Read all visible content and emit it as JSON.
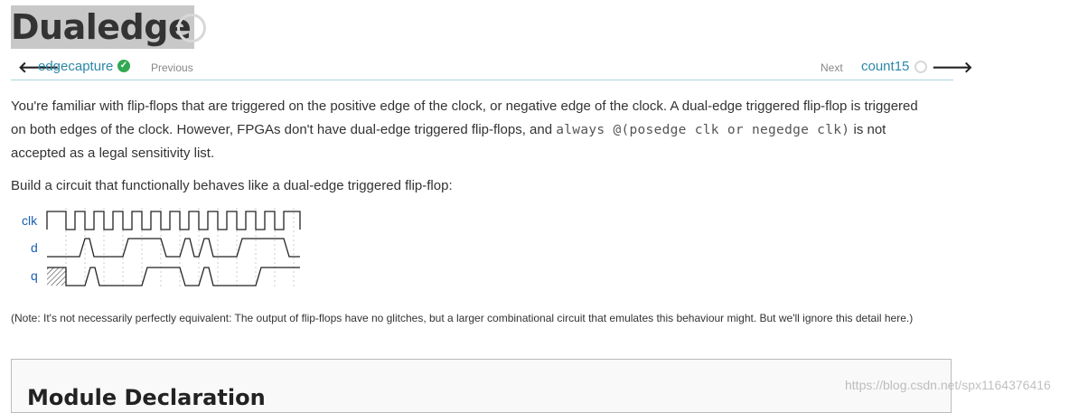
{
  "page": {
    "title": "Dualedge"
  },
  "nav": {
    "prev_problem": "edgecapture",
    "prev_label": "Previous",
    "next_label": "Next",
    "next_problem": "count15"
  },
  "content": {
    "p1_a": "You're familiar with flip-flops that are triggered on the positive edge of the clock, or negative edge of the clock. A dual-edge triggered flip-flop is triggered on both edges of the clock. However, FPGAs don't have dual-edge triggered flip-flops, and ",
    "p1_code": "always @(posedge clk or negedge clk)",
    "p1_b": " is not accepted as a legal sensitivity list.",
    "p2": "Build a circuit that functionally behaves like a dual-edge triggered flip-flop:",
    "note": "(Note: It's not necessarily perfectly equivalent: The output of flip-flops have no glitches, but a larger combinational circuit that emulates this behaviour might. But we'll ignore this detail here.)"
  },
  "waveform": {
    "signals": [
      "clk",
      "d",
      "q"
    ]
  },
  "module": {
    "heading": "Module Declaration"
  },
  "watermark": "https://blog.csdn.net/spx1164376416",
  "colors": {
    "link": "#2a88a8",
    "signal_label": "#1a5fb4",
    "done": "#33a852"
  }
}
